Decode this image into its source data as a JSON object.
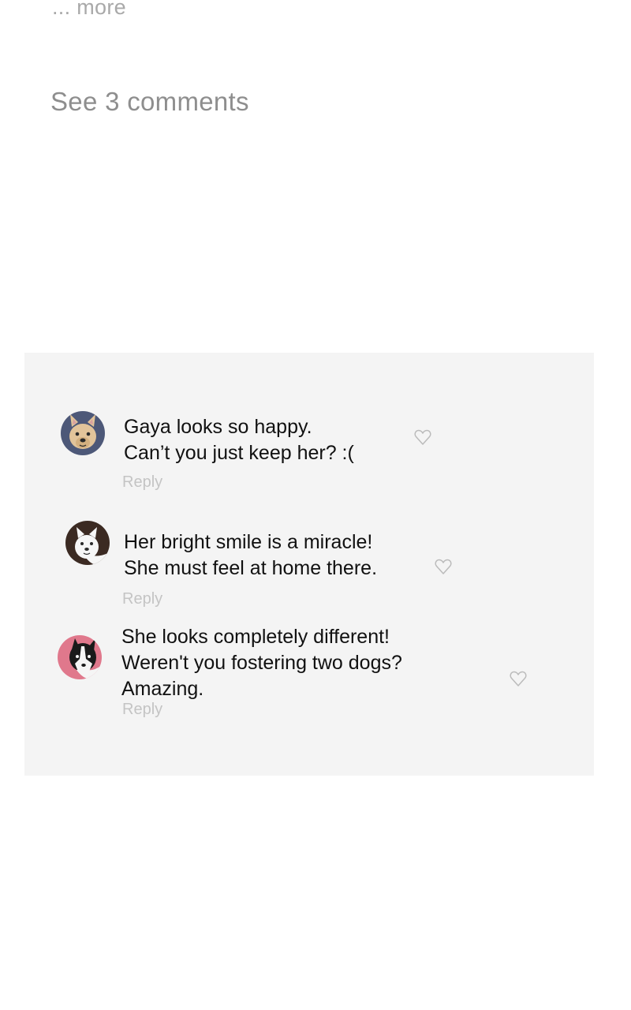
{
  "post": {
    "more_label": "... more",
    "see_comments_label": "See 3 comments"
  },
  "comments": [
    {
      "lines": [
        "Gaya looks so happy.",
        "Can’t you just keep her? :("
      ],
      "reply_label": "Reply",
      "avatar_icon": "french-bulldog-avatar",
      "avatar_bg": "#4d5878"
    },
    {
      "lines": [
        "Her bright smile is a miracle!",
        "She must feel at home there."
      ],
      "reply_label": "Reply",
      "avatar_icon": "white-dog-avatar",
      "avatar_bg": "#3b2a22"
    },
    {
      "lines": [
        "She looks completely different!",
        "Weren't you fostering two dogs?",
        "Amazing."
      ],
      "reply_label": "Reply",
      "avatar_icon": "border-collie-avatar",
      "avatar_bg": "#e0788c"
    }
  ],
  "colors": {
    "panel_bg": "#f4f4f4",
    "muted_text": "#a9a9a9",
    "reply_text": "#c4c4c4",
    "heart_stroke": "#bbbbbb"
  }
}
